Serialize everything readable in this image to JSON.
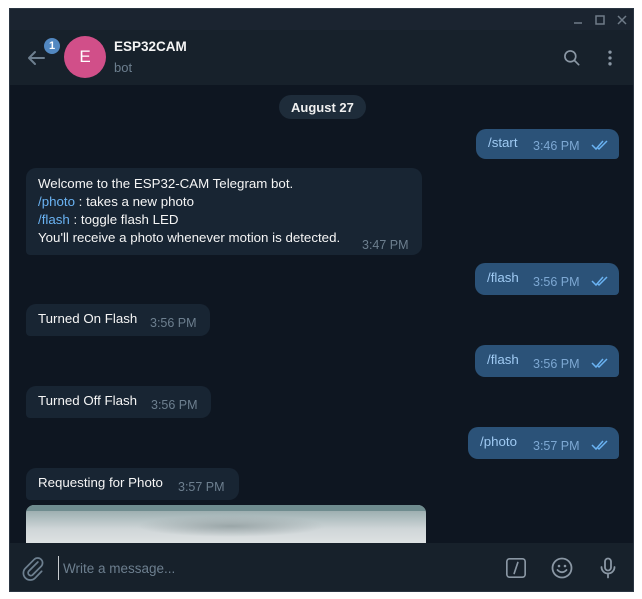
{
  "window": {
    "controls": [
      "minimize",
      "maximize",
      "close"
    ]
  },
  "header": {
    "back_icon": "arrow-left-icon",
    "unread_count": "1",
    "avatar_letter": "E",
    "avatar_color": "#d14f89",
    "chat_name": "ESP32CAM",
    "chat_status": "bot",
    "search_icon": "search-icon",
    "menu_icon": "more-vertical-icon"
  },
  "messages": {
    "date": "August 27",
    "list": [
      {
        "dir": "out",
        "text": "/start",
        "time": "3:46 PM",
        "read": true
      },
      {
        "dir": "in",
        "lines": {
          "l1": "Welcome to the ESP32-CAM Telegram bot.",
          "l2_cmd": "/photo",
          "l2_rest": " : takes a new photo",
          "l3_cmd": "/flash",
          "l3_rest": " : toggle flash LED",
          "l4": "You'll receive a photo whenever motion is detected."
        },
        "time": "3:47 PM"
      },
      {
        "dir": "out",
        "text": "/flash",
        "time": "3:56 PM",
        "read": true
      },
      {
        "dir": "in",
        "text": "Turned On Flash",
        "time": "3:56 PM"
      },
      {
        "dir": "out",
        "text": "/flash",
        "time": "3:56 PM",
        "read": true
      },
      {
        "dir": "in",
        "text": "Turned Off Flash",
        "time": "3:56 PM"
      },
      {
        "dir": "out",
        "text": "/photo",
        "time": "3:57 PM",
        "read": true
      },
      {
        "dir": "in",
        "text": "Requesting for Photo",
        "time": "3:57 PM"
      }
    ]
  },
  "composer": {
    "placeholder": "Write a message...",
    "attach_icon": "paperclip-icon",
    "commands_icon": "slash-command-icon",
    "emoji_icon": "emoji-icon",
    "mic_icon": "microphone-icon"
  },
  "colors": {
    "background": "#0e1621",
    "header": "#17212b",
    "incoming_bubble": "#182533",
    "outgoing_bubble": "#2b5278",
    "link": "#6ab3f3"
  }
}
